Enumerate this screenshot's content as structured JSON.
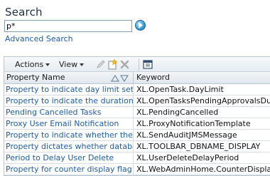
{
  "page_title": "Search",
  "search": {
    "value": "p*",
    "placeholder": ""
  },
  "advanced_search_label": "Advanced Search",
  "toolbar": {
    "actions_label": "Actions",
    "view_label": "View"
  },
  "table": {
    "columns": [
      "Property Name",
      "Keyword"
    ],
    "rows": [
      {
        "name": "Property to indicate day limit set for clo",
        "keyword": "XL.OpenTask.DayLimit"
      },
      {
        "name": "Property to indicate the duration in mins",
        "keyword": "XL.OpenTasksPendingApprovalsDuration"
      },
      {
        "name": "Pending Cancelled Tasks",
        "keyword": "XL.PendingCancelled"
      },
      {
        "name": "Proxy User Email Notification",
        "keyword": "XL.ProxyNotificationTemplate"
      },
      {
        "name": "Property to indicate whether the audit",
        "keyword": "XL.SendAuditJMSMessage"
      },
      {
        "name": "Property dictates whether database",
        "keyword": "XL.TOOLBAR_DBNAME_DISPLAY"
      },
      {
        "name": "Period to Delay User Delete",
        "keyword": "XL.UserDeleteDelayPeriod"
      },
      {
        "name": "Property for counter display flag for cl",
        "keyword": "XL.WebAdminHome.CounterDisplay.Ty"
      }
    ]
  },
  "colors": {
    "link": "#1d5dab",
    "border": "#b9c7d3",
    "title": "#1a2e44"
  }
}
